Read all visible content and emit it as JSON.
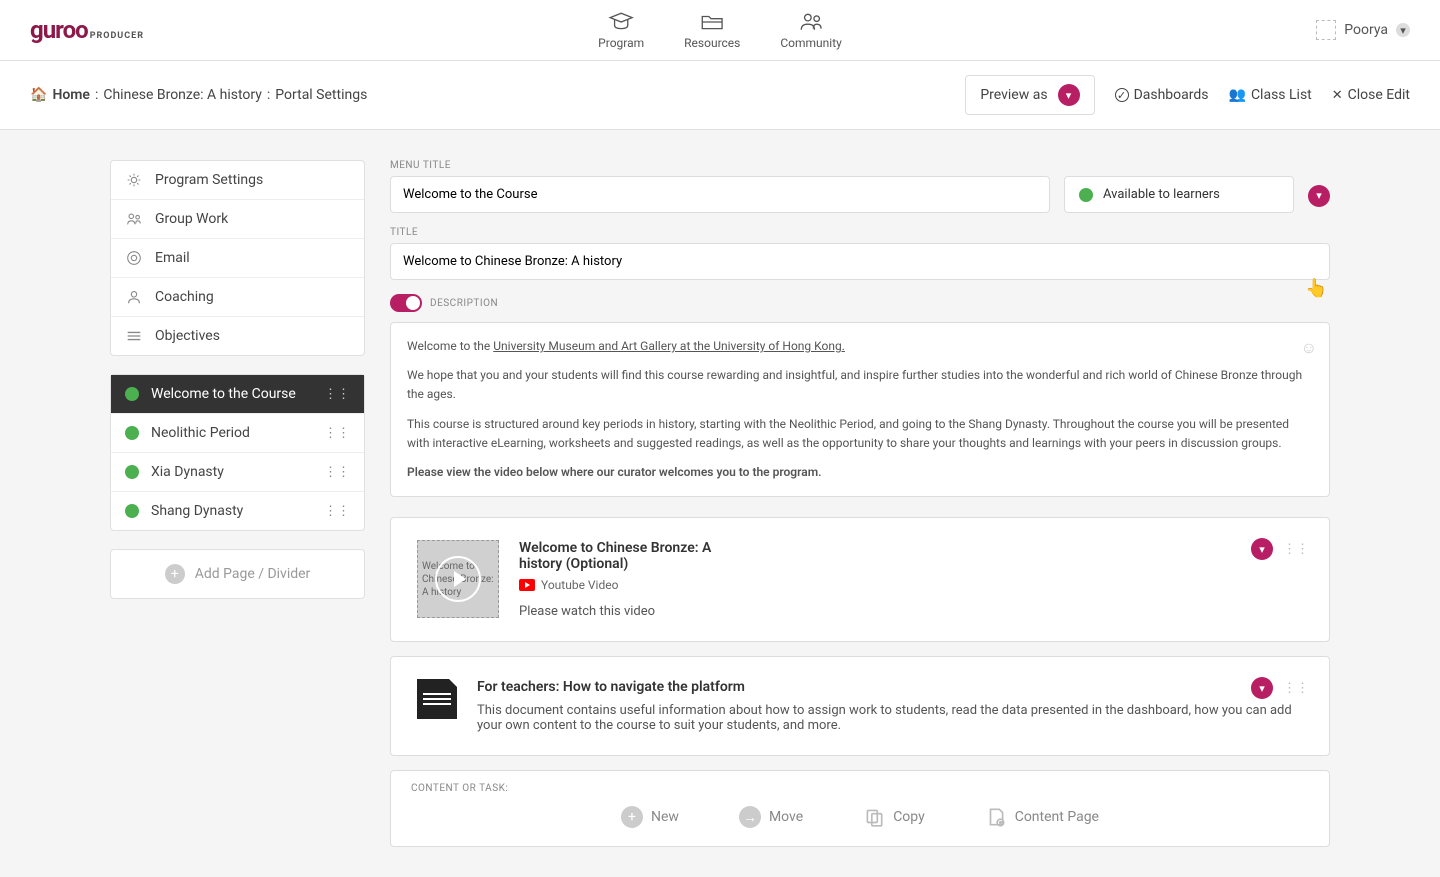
{
  "brand": {
    "main": "guroo",
    "sub": "PRODUCER"
  },
  "nav": {
    "program": "Program",
    "resources": "Resources",
    "community": "Community"
  },
  "user": {
    "name": "Poorya"
  },
  "breadcrumb": {
    "home": "Home",
    "sep1": ":",
    "course": "Chinese Bronze: A history",
    "sep2": ":",
    "page": "Portal Settings"
  },
  "toolbar": {
    "preview": "Preview as",
    "dashboards": "Dashboards",
    "class_list": "Class List",
    "close_edit": "Close Edit"
  },
  "settings": {
    "program": "Program Settings",
    "group": "Group Work",
    "email": "Email",
    "coaching": "Coaching",
    "objectives": "Objectives"
  },
  "modules": [
    {
      "label": "Welcome to the Course"
    },
    {
      "label": "Neolithic Period"
    },
    {
      "label": "Xia Dynasty"
    },
    {
      "label": "Shang Dynasty"
    }
  ],
  "add_page": "Add Page / Divider",
  "fields": {
    "menu_title_label": "MENU TITLE",
    "menu_title_value": "Welcome to the Course",
    "status_value": "Available to learners",
    "title_label": "TITLE",
    "title_value": "Welcome to Chinese Bronze: A history",
    "description_label": "DESCRIPTION"
  },
  "description": {
    "p1_prefix": "Welcome to the ",
    "p1_link": "University Museum and Art Gallery at the University of Hong Kong.",
    "p2": "We hope that you and your students will find this course rewarding and insightful, and inspire further studies into the wonderful and rich world of Chinese Bronze through the ages.",
    "p3": "This course is structured around key periods in history, starting with the Neolithic Period, and going to the Shang Dynasty. Throughout the course you will be presented with interactive eLearning, worksheets and suggested readings, as well as the opportunity to share your thoughts and learnings with your peers in discussion groups.",
    "p4": "Please view the video below where our curator welcomes you to the program."
  },
  "video_block": {
    "thumb_alt": "Welcome to Chinese Bronze: A history",
    "title": "Welcome to Chinese Bronze: A history (Optional)",
    "type": "Youtube Video",
    "desc": "Please watch this video"
  },
  "doc_block": {
    "title": "For teachers: How to navigate the platform",
    "desc": "This document contains useful information about how to assign work to students, read the data presented in the dashboard, how you can add your own content to the course to suit your students, and more."
  },
  "content_task": {
    "label": "CONTENT OR TASK:",
    "new": "New",
    "move": "Move",
    "copy": "Copy",
    "content_page": "Content Page"
  }
}
